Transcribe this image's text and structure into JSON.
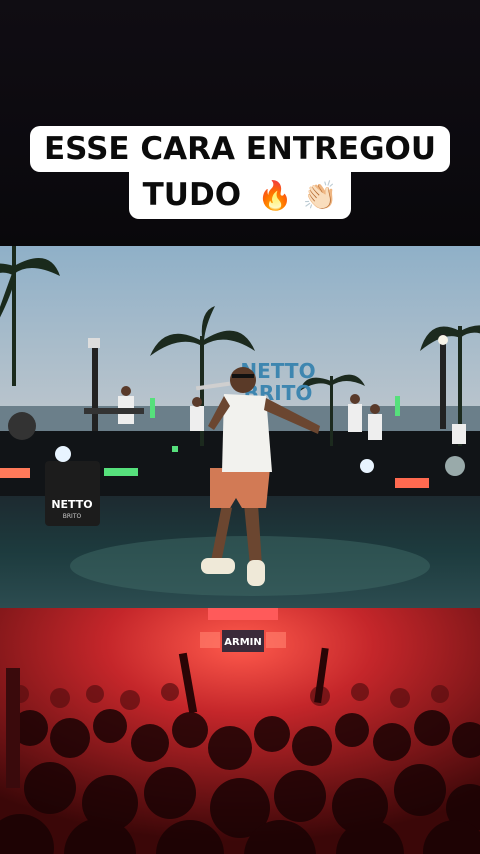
{
  "caption": {
    "line1": "ESSE CARA ENTREGOU",
    "line2": "TUDO",
    "emojis": "🔥 👏🏻"
  },
  "stage": {
    "logo_text_top": "NETTO",
    "logo_text_bottom": "BRITO",
    "speaker_logo": "NETTO",
    "speaker_logo_sub": "BRITO"
  },
  "crowd_screen": {
    "text": "ARMIN"
  },
  "colors": {
    "sky_top": "#8fb0c8",
    "sunset": "#f0a86a",
    "water": "#1d3b3e",
    "crowd_red": "#c4262a"
  }
}
